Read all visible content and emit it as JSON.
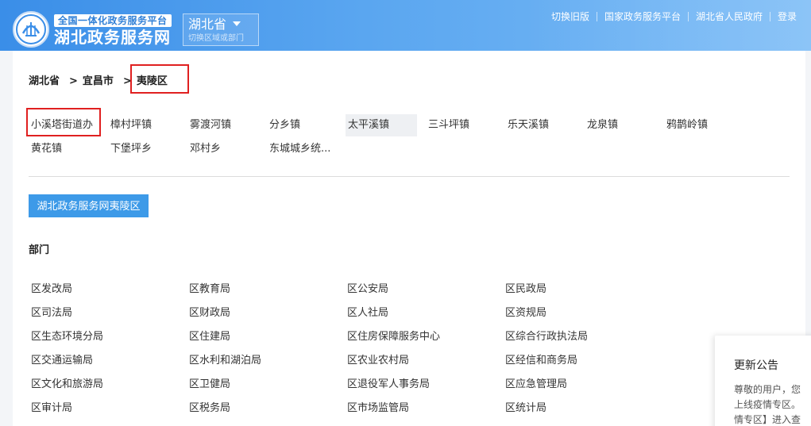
{
  "header": {
    "logo_subtitle": "全国一体化政务服务平台",
    "logo_title": "湖北政务服务网",
    "region": {
      "name": "湖北省",
      "switch_label": "切换区域或部门"
    },
    "links": [
      "切换旧版",
      "国家政务服务平台",
      "湖北省人民政府",
      "登录"
    ]
  },
  "breadcrumb": {
    "items": [
      "湖北省",
      "宜昌市"
    ],
    "separator": ">",
    "current": "夷陵区"
  },
  "towns": [
    "小溪塔街道办",
    "樟村坪镇",
    "雾渡河镇",
    "分乡镇",
    "太平溪镇",
    "三斗坪镇",
    "乐天溪镇",
    "龙泉镇",
    "鸦鹊岭镇",
    "黄花镇",
    "下堡坪乡",
    "邓村乡",
    "东城城乡统..."
  ],
  "site_button": "湖北政务服务网夷陵区",
  "departments": {
    "heading": "部门",
    "items": [
      "区发改局",
      "区教育局",
      "区公安局",
      "区民政局",
      "区司法局",
      "区财政局",
      "区人社局",
      "区资规局",
      "区生态环境分局",
      "区住建局",
      "区住房保障服务中心",
      "区综合行政执法局",
      "区交通运输局",
      "区水利和湖泊局",
      "区农业农村局",
      "区经信和商务局",
      "区文化和旅游局",
      "区卫健局",
      "区退役军人事务局",
      "区应急管理局",
      "区审计局",
      "区税务局",
      "区市场监管局",
      "区统计局"
    ]
  },
  "notice": {
    "title": "更新公告",
    "lines": [
      "尊敬的用户，您",
      "上线疫情专区。",
      "情专区】进入查"
    ]
  },
  "colors": {
    "header_start": "#3a8ee8",
    "accent": "#3d9ae8",
    "highlight": "#e02020"
  }
}
